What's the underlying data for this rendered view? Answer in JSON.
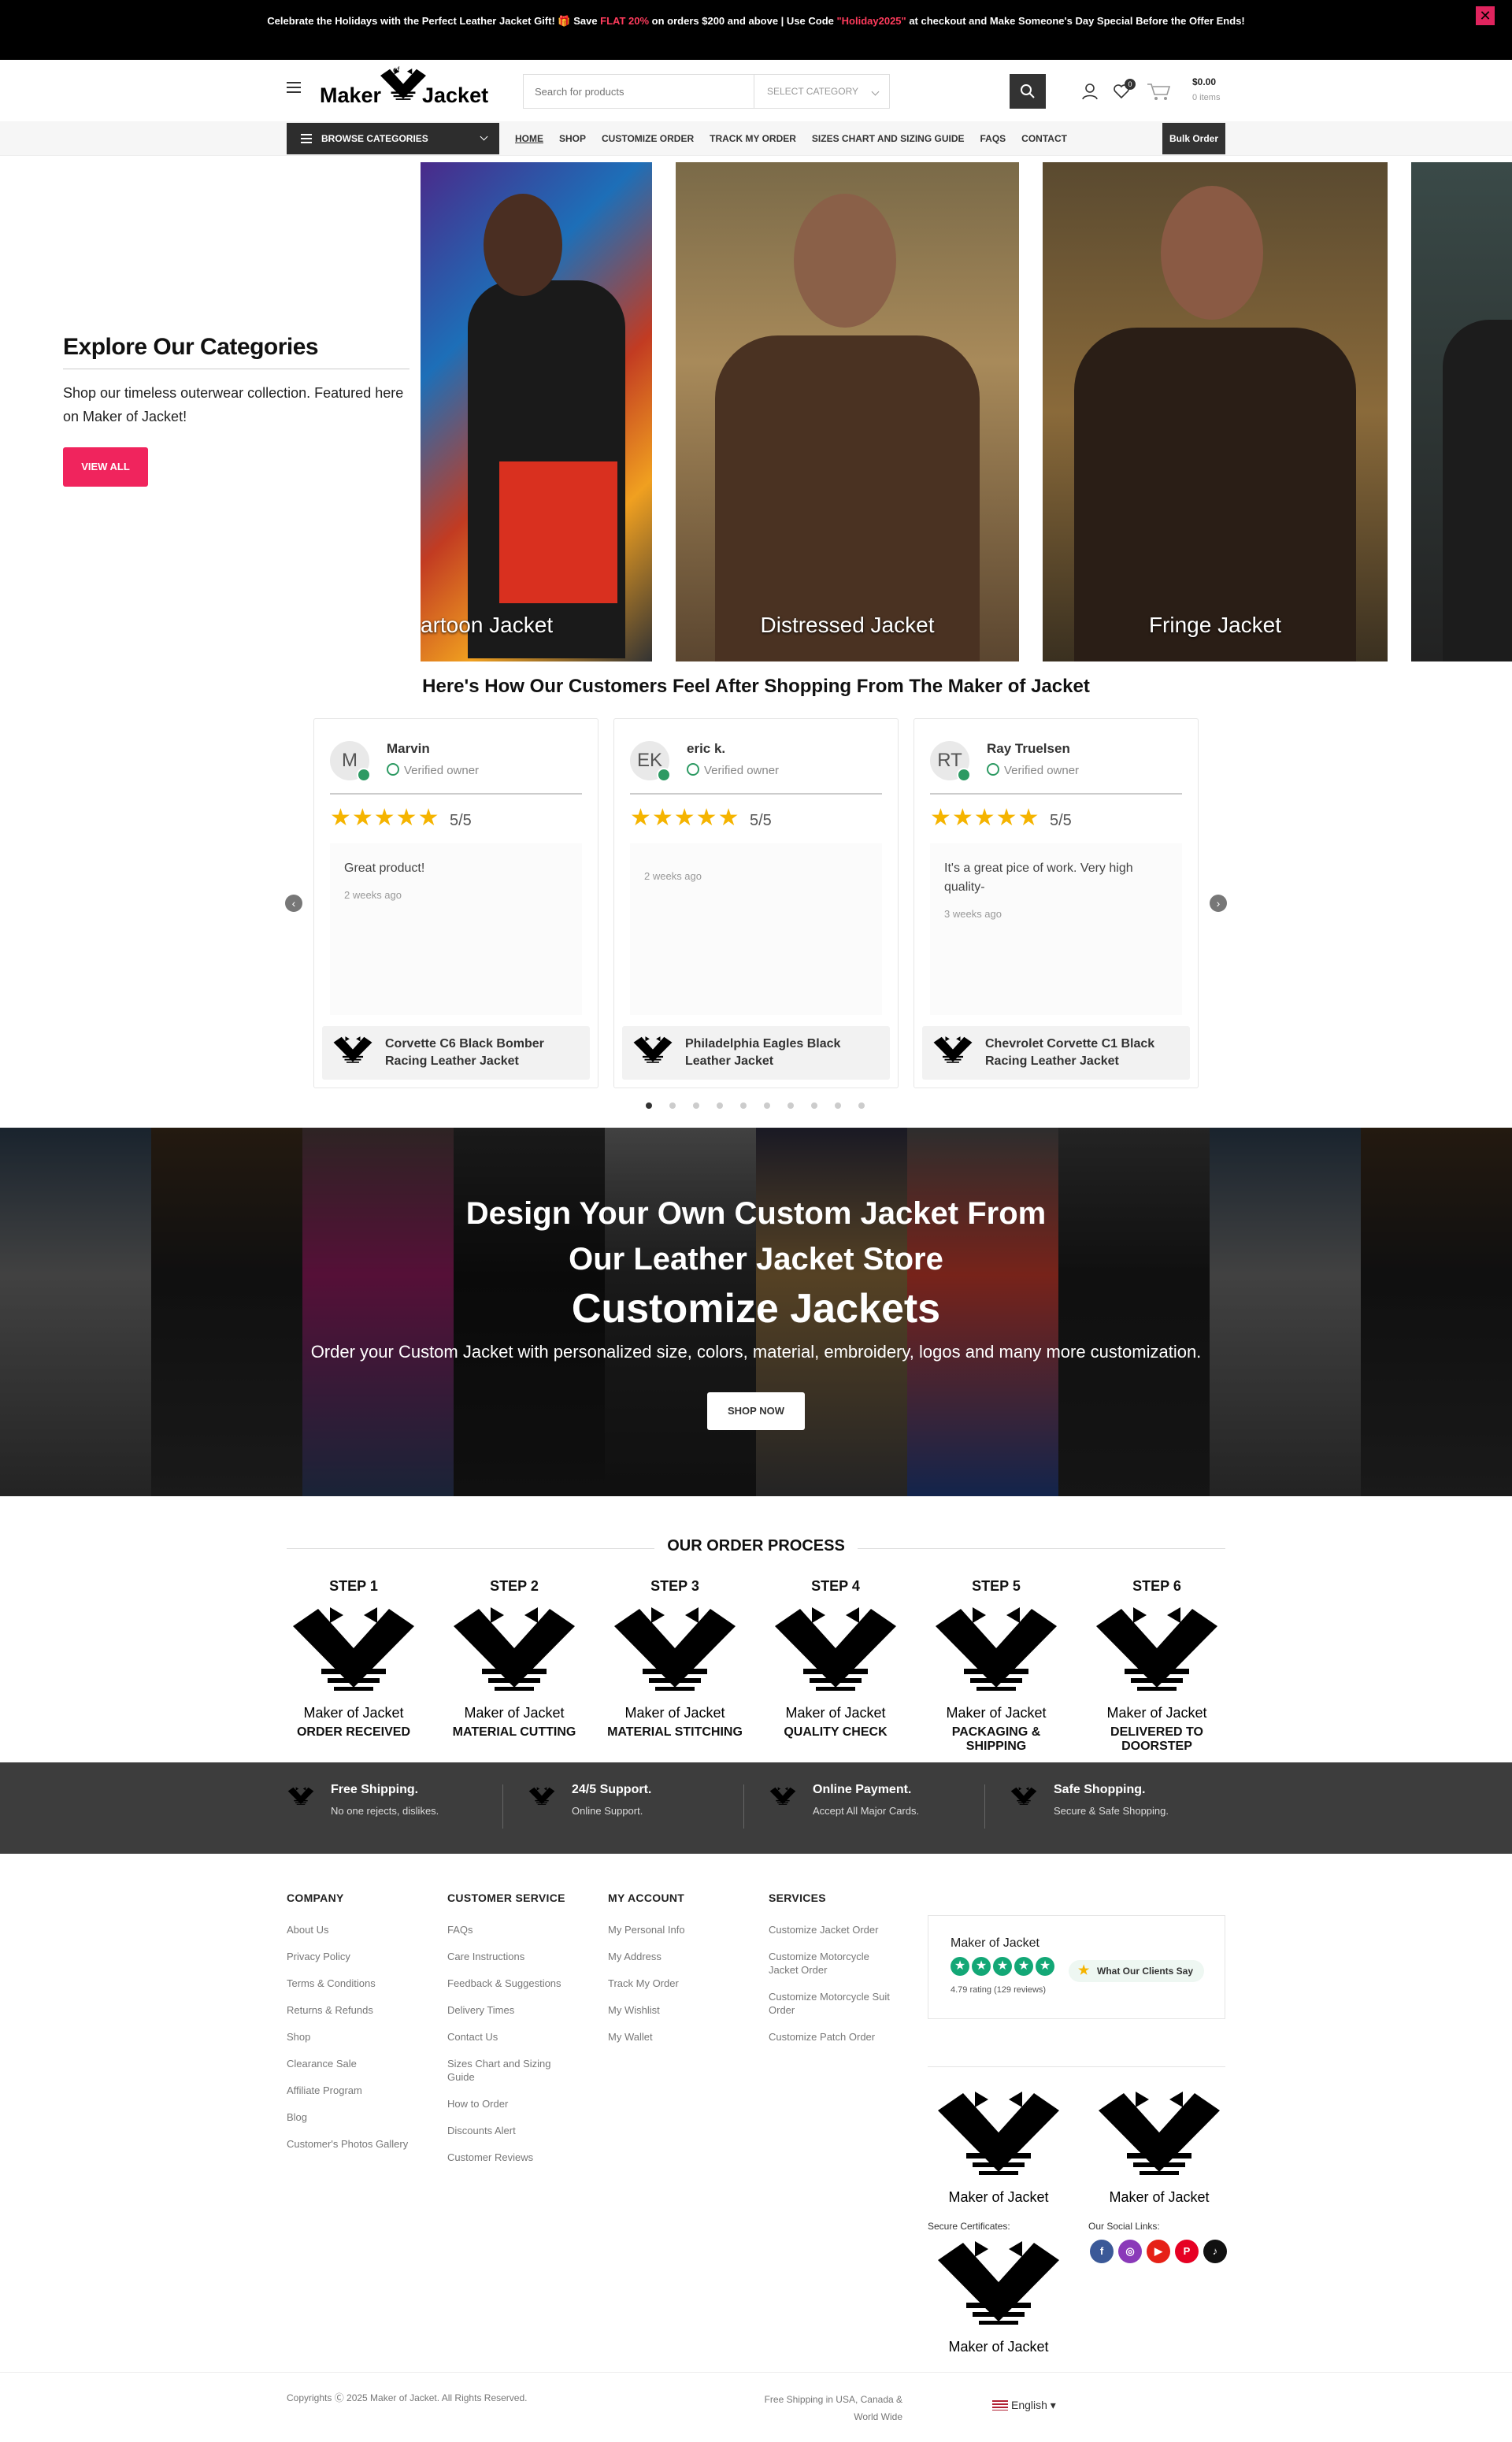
{
  "announcement": {
    "text_before": "Celebrate the Holidays with the Perfect Leather Jacket Gift! 🎁 Save ",
    "highlight_1": "FLAT 20%",
    "text_mid": " on orders $200 and above | Use Code ",
    "highlight_2": "\"Holiday2025\"",
    "text_after": " at checkout and Make Someone's Day Special Before the Offer Ends!",
    "close": "✕"
  },
  "header": {
    "logo_text_left": "Maker",
    "logo_text_right": "Jacket",
    "logo_of": "of",
    "search_placeholder": "Search for products",
    "category_select": "SELECT CATEGORY",
    "cart_total": "$0.00",
    "cart_items": "0 items",
    "wishlist_count": "0"
  },
  "nav": {
    "browse_label": "BROWSE CATEGORIES",
    "links": [
      "HOME",
      "SHOP",
      "CUSTOMIZE ORDER",
      "TRACK MY ORDER",
      "SIZES CHART AND SIZING GUIDE",
      "FAQS",
      "CONTACT"
    ],
    "bulk_order": "Bulk Order"
  },
  "explore": {
    "title": "Explore Our Categories",
    "description": "Shop our timeless outerwear collection. Featured here on Maker of Jacket!",
    "button": "VIEW ALL",
    "categories": [
      "artoon Jacket",
      "Distressed Jacket",
      "Fringe Jacket"
    ]
  },
  "reviews": {
    "title": "Here's How Our Customers Feel After Shopping From The Maker of Jacket",
    "prev": "‹",
    "next": "›",
    "items": [
      {
        "initial": "M",
        "name": "Marvin",
        "verified": "Verified owner",
        "stars": "★★★★★",
        "score": "5/5",
        "text": "Great product!",
        "ago": "2 weeks ago",
        "product": "Corvette C6 Black Bomber Racing Leather Jacket"
      },
      {
        "initial": "EK",
        "name": "eric k.",
        "verified": "Verified owner",
        "stars": "★★★★★",
        "score": "5/5",
        "text": "",
        "ago": "2 weeks ago",
        "product": "Philadelphia Eagles Black Leather Jacket"
      },
      {
        "initial": "RT",
        "name": "Ray Truelsen",
        "verified": "Verified owner",
        "stars": "★★★★★",
        "score": "5/5",
        "text": "It's a great pice of work. Very high quality-",
        "ago": "3 weeks ago",
        "product": "Chevrolet Corvette C1 Black Racing Leather Jacket"
      }
    ],
    "dot_count": 10,
    "active_dot": 1
  },
  "banner": {
    "heading": "Design Your Own Custom Jacket From Our Leather Jacket Store",
    "subheading": "Customize Jackets",
    "text": "Order your Custom Jacket with personalized size, colors, material, embroidery, logos and many more customization.",
    "button": "SHOP NOW"
  },
  "process": {
    "title": "OUR ORDER PROCESS",
    "steps": [
      {
        "label": "STEP 1",
        "name": "ORDER RECEIVED"
      },
      {
        "label": "STEP 2",
        "name": "MATERIAL CUTTING"
      },
      {
        "label": "STEP 3",
        "name": "MATERIAL STITCHING"
      },
      {
        "label": "STEP 4",
        "name": "QUALITY CHECK"
      },
      {
        "label": "STEP 5",
        "name": "PACKAGING & SHIPPING"
      },
      {
        "label": "STEP 6",
        "name": "DELIVERED TO DOORSTEP"
      }
    ],
    "logo_caption": "Maker of Jacket"
  },
  "features": [
    {
      "title": "Free Shipping.",
      "desc": "No one rejects, dislikes."
    },
    {
      "title": "24/5 Support.",
      "desc": "Online Support."
    },
    {
      "title": "Online Payment.",
      "desc": "Accept All Major Cards."
    },
    {
      "title": "Safe Shopping.",
      "desc": "Secure & Safe Shopping."
    }
  ],
  "footer": {
    "company": {
      "title": "COMPANY",
      "links": [
        "About Us",
        "Privacy Policy",
        "Terms & Conditions",
        "Returns & Refunds",
        "Shop",
        "Clearance Sale",
        "Affiliate Program",
        "Blog",
        "Customer's Photos Gallery"
      ]
    },
    "customer_service": {
      "title": "CUSTOMER SERVICE",
      "links": [
        "FAQs",
        "Care Instructions",
        "Feedback & Suggestions",
        "Delivery Times",
        "Contact Us",
        "Sizes Chart and Sizing Guide",
        "How to Order",
        "Discounts Alert",
        "Customer Reviews"
      ]
    },
    "my_account": {
      "title": "MY ACCOUNT",
      "links": [
        "My Personal Info",
        "My Address",
        "Track My Order",
        "My Wishlist",
        "My Wallet"
      ]
    },
    "services": {
      "title": "SERVICES",
      "links": [
        "Customize Jacket Order",
        "Customize Motorcycle Jacket Order",
        "Customize Motorcycle Suit Order",
        "Customize Patch Order"
      ]
    },
    "trust": {
      "name": "Maker of Jacket",
      "rating": "4.79 rating (129 reviews)",
      "button": "What Our Clients Say"
    },
    "secure_label": "Secure Certificates:",
    "social_label": "Our Social Links:",
    "socials": [
      {
        "icon": "facebook-icon",
        "glyph": "f",
        "color": "#3b5998"
      },
      {
        "icon": "instagram-icon",
        "glyph": "◎",
        "color": "#8a3ab9"
      },
      {
        "icon": "youtube-icon",
        "glyph": "▶",
        "color": "#e62117"
      },
      {
        "icon": "pinterest-icon",
        "glyph": "P",
        "color": "#e60023"
      },
      {
        "icon": "tiktok-icon",
        "glyph": "♪",
        "color": "#111111"
      }
    ],
    "copyright": "Copyrights Ⓒ 2025 Maker of Jacket. All Rights Reserved.",
    "ship_note": "Free Shipping in USA, Canada & World Wide",
    "language": "English"
  },
  "colors": {
    "accent": "#f0245d",
    "dark": "#2d2d2d",
    "feature_bg": "#3d3d3d"
  }
}
